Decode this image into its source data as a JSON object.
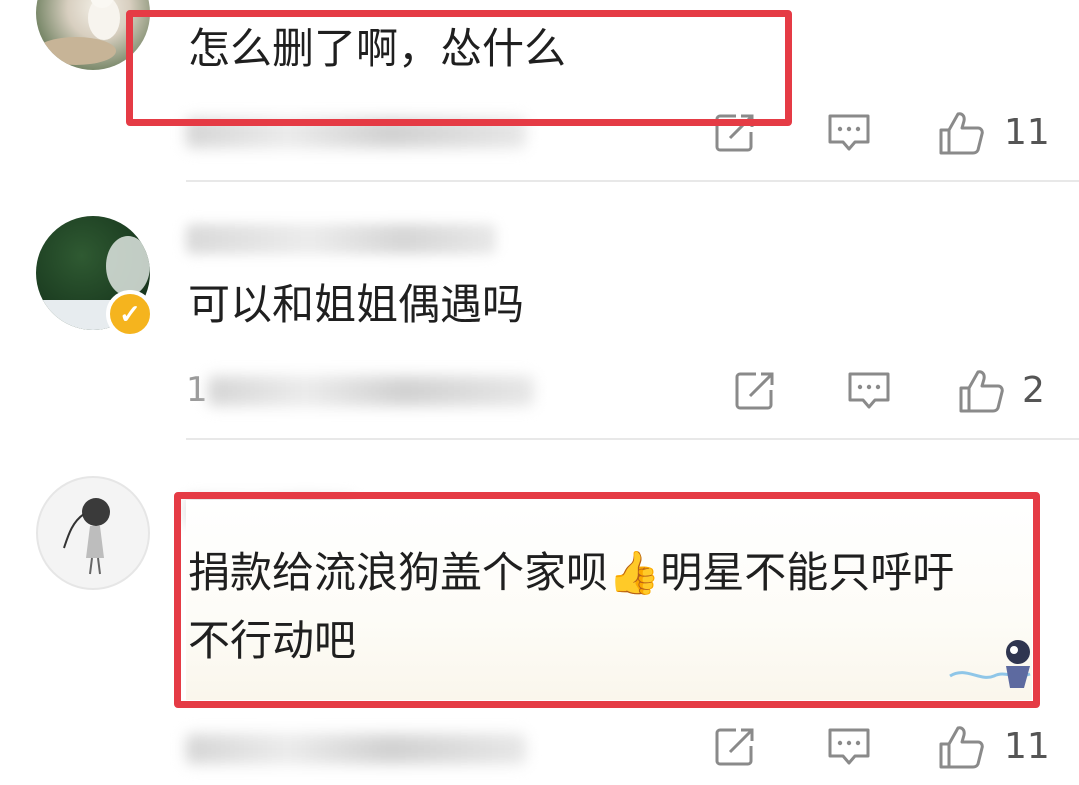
{
  "comments": [
    {
      "text": "怎么删了啊，怂什么",
      "likes": "11"
    },
    {
      "text": "可以和姐姐偶遇吗",
      "meta_partial": "1",
      "likes": "2"
    },
    {
      "text_line1": "捐款给流浪狗盖个家呗👍明星不能只呼吁",
      "text_line2": "不行动吧",
      "likes": "11"
    }
  ],
  "colors": {
    "highlight": "#e53b45",
    "verified_badge": "#f5b41e",
    "icon": "#8a8a8a"
  },
  "icons": [
    "share-icon",
    "comment-icon",
    "like-icon",
    "verified-icon"
  ]
}
